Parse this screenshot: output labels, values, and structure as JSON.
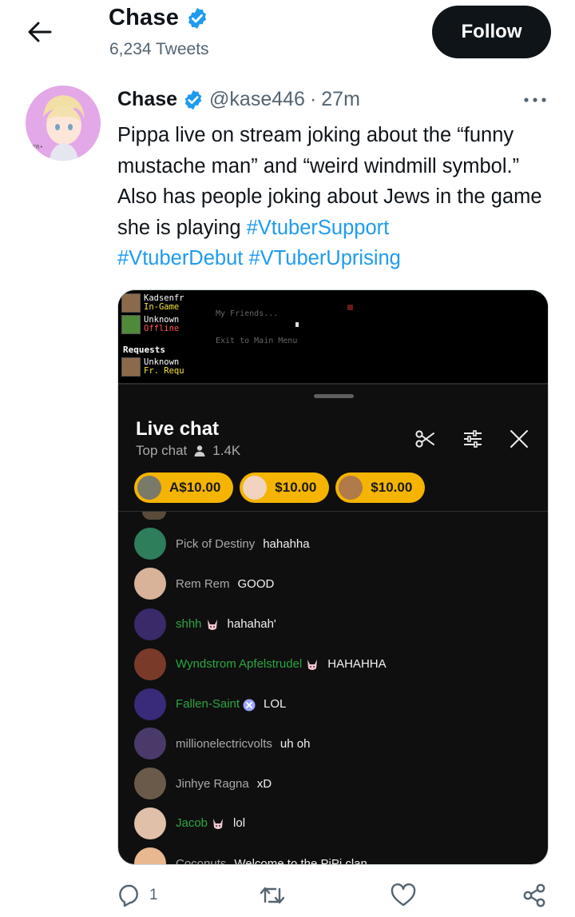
{
  "header": {
    "name": "Chase",
    "tweet_count": "6,234 Tweets",
    "follow_label": "Follow"
  },
  "tweet": {
    "author": "Chase",
    "handle": "@kase446",
    "dot": "·",
    "time": "27m",
    "text_plain": "Pippa live on stream joking about the “funny mustache man” and “weird windmill symbol.” Also has people joking about Jews in the game she is playing ",
    "hashtags": [
      "#VtuberSupport",
      "#VtuberDebut",
      "#VTuberUprising"
    ]
  },
  "game": {
    "rows": [
      {
        "name": "Kadsenfr",
        "status": "In-Game",
        "status_color": "#f5e23c"
      },
      {
        "name": "Unknown",
        "status": "Offline",
        "status_color": "#ff5555"
      },
      {
        "name": "Unknown",
        "status": "Fr. Requ",
        "status_color": "#f5e23c"
      }
    ],
    "requests_label": "Requests",
    "menu_items": [
      "My Friends...",
      "Exit to Main Menu"
    ]
  },
  "chat": {
    "title": "Live chat",
    "subtitle": "Top chat",
    "viewers": "1.4K",
    "superchats": [
      {
        "amount": "A$10.00",
        "color": "#7a7a6a"
      },
      {
        "amount": "$10.00",
        "color": "#f1d3c0"
      },
      {
        "amount": "$10.00",
        "color": "#b07a4a"
      }
    ],
    "messages": [
      {
        "author": "Pick of Destiny",
        "text": "hahahha",
        "member": false,
        "badge": "",
        "avatar_color": "#2e7d5b"
      },
      {
        "author": "Rem Rem",
        "text": "GOOD",
        "member": false,
        "badge": "",
        "avatar_color": "#d8b39a"
      },
      {
        "author": "shhh",
        "text": "hahahah'",
        "member": true,
        "badge": "bunny-badge-icon",
        "avatar_color": "#3a2a6a"
      },
      {
        "author": "Wyndstrom Apfelstrudel",
        "text": "HAHAHHA",
        "member": true,
        "badge": "bunny-badge-icon",
        "avatar_color": "#7a3a2a"
      },
      {
        "author": "Fallen-Saint",
        "text": "LOL",
        "member": true,
        "badge": "x-badge-icon",
        "avatar_color": "#3a2a7a"
      },
      {
        "author": "millionelectricvolts",
        "text": "uh oh",
        "member": false,
        "badge": "",
        "avatar_color": "#4a3a6a"
      },
      {
        "author": "Jinhye Ragna",
        "text": "xD",
        "member": false,
        "badge": "",
        "avatar_color": "#6a5a4a"
      },
      {
        "author": "Jacob",
        "text": "lol",
        "member": true,
        "badge": "bunny-badge-icon",
        "avatar_color": "#e0c0a8"
      },
      {
        "author": "Coconuts",
        "text": "Welcome to the PiPi clan",
        "member": false,
        "badge": "",
        "avatar_color": "#e8b890"
      }
    ]
  },
  "actions": {
    "reply_count": "1"
  },
  "colors": {
    "link_blue": "#1d9bf0",
    "verified_blue": "#1d9bf0",
    "member_green": "#2ba640",
    "superchat_gold": "#f4b400"
  }
}
